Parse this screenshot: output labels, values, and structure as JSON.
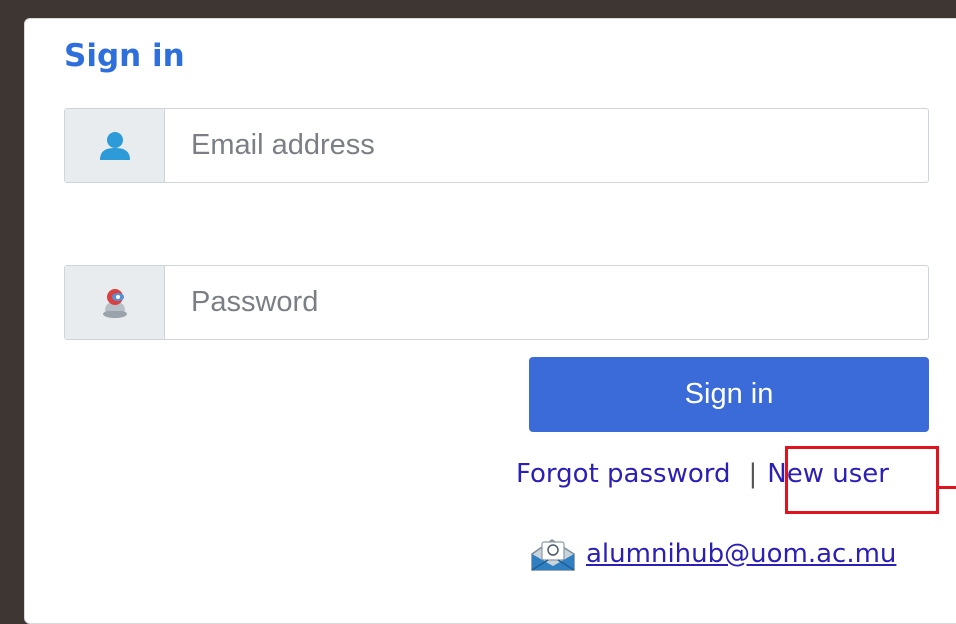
{
  "form": {
    "title": "Sign in",
    "email": {
      "icon": "user-icon",
      "placeholder": "Email address",
      "value": ""
    },
    "password": {
      "icon": "key-user-icon",
      "placeholder": "Password",
      "value": ""
    },
    "submit_label": "Sign in",
    "forgot_password_label": "Forgot password",
    "separator": "|",
    "new_user_label": "New user",
    "contact_email": "alumnihub@uom.ac.mu",
    "contact_icon": "mail-envelope-icon"
  },
  "colors": {
    "background": "#3e3632",
    "title": "#2f6fdc",
    "button": "#3a6bd8",
    "link": "#2b1fb6",
    "highlight": "#e0141e"
  }
}
